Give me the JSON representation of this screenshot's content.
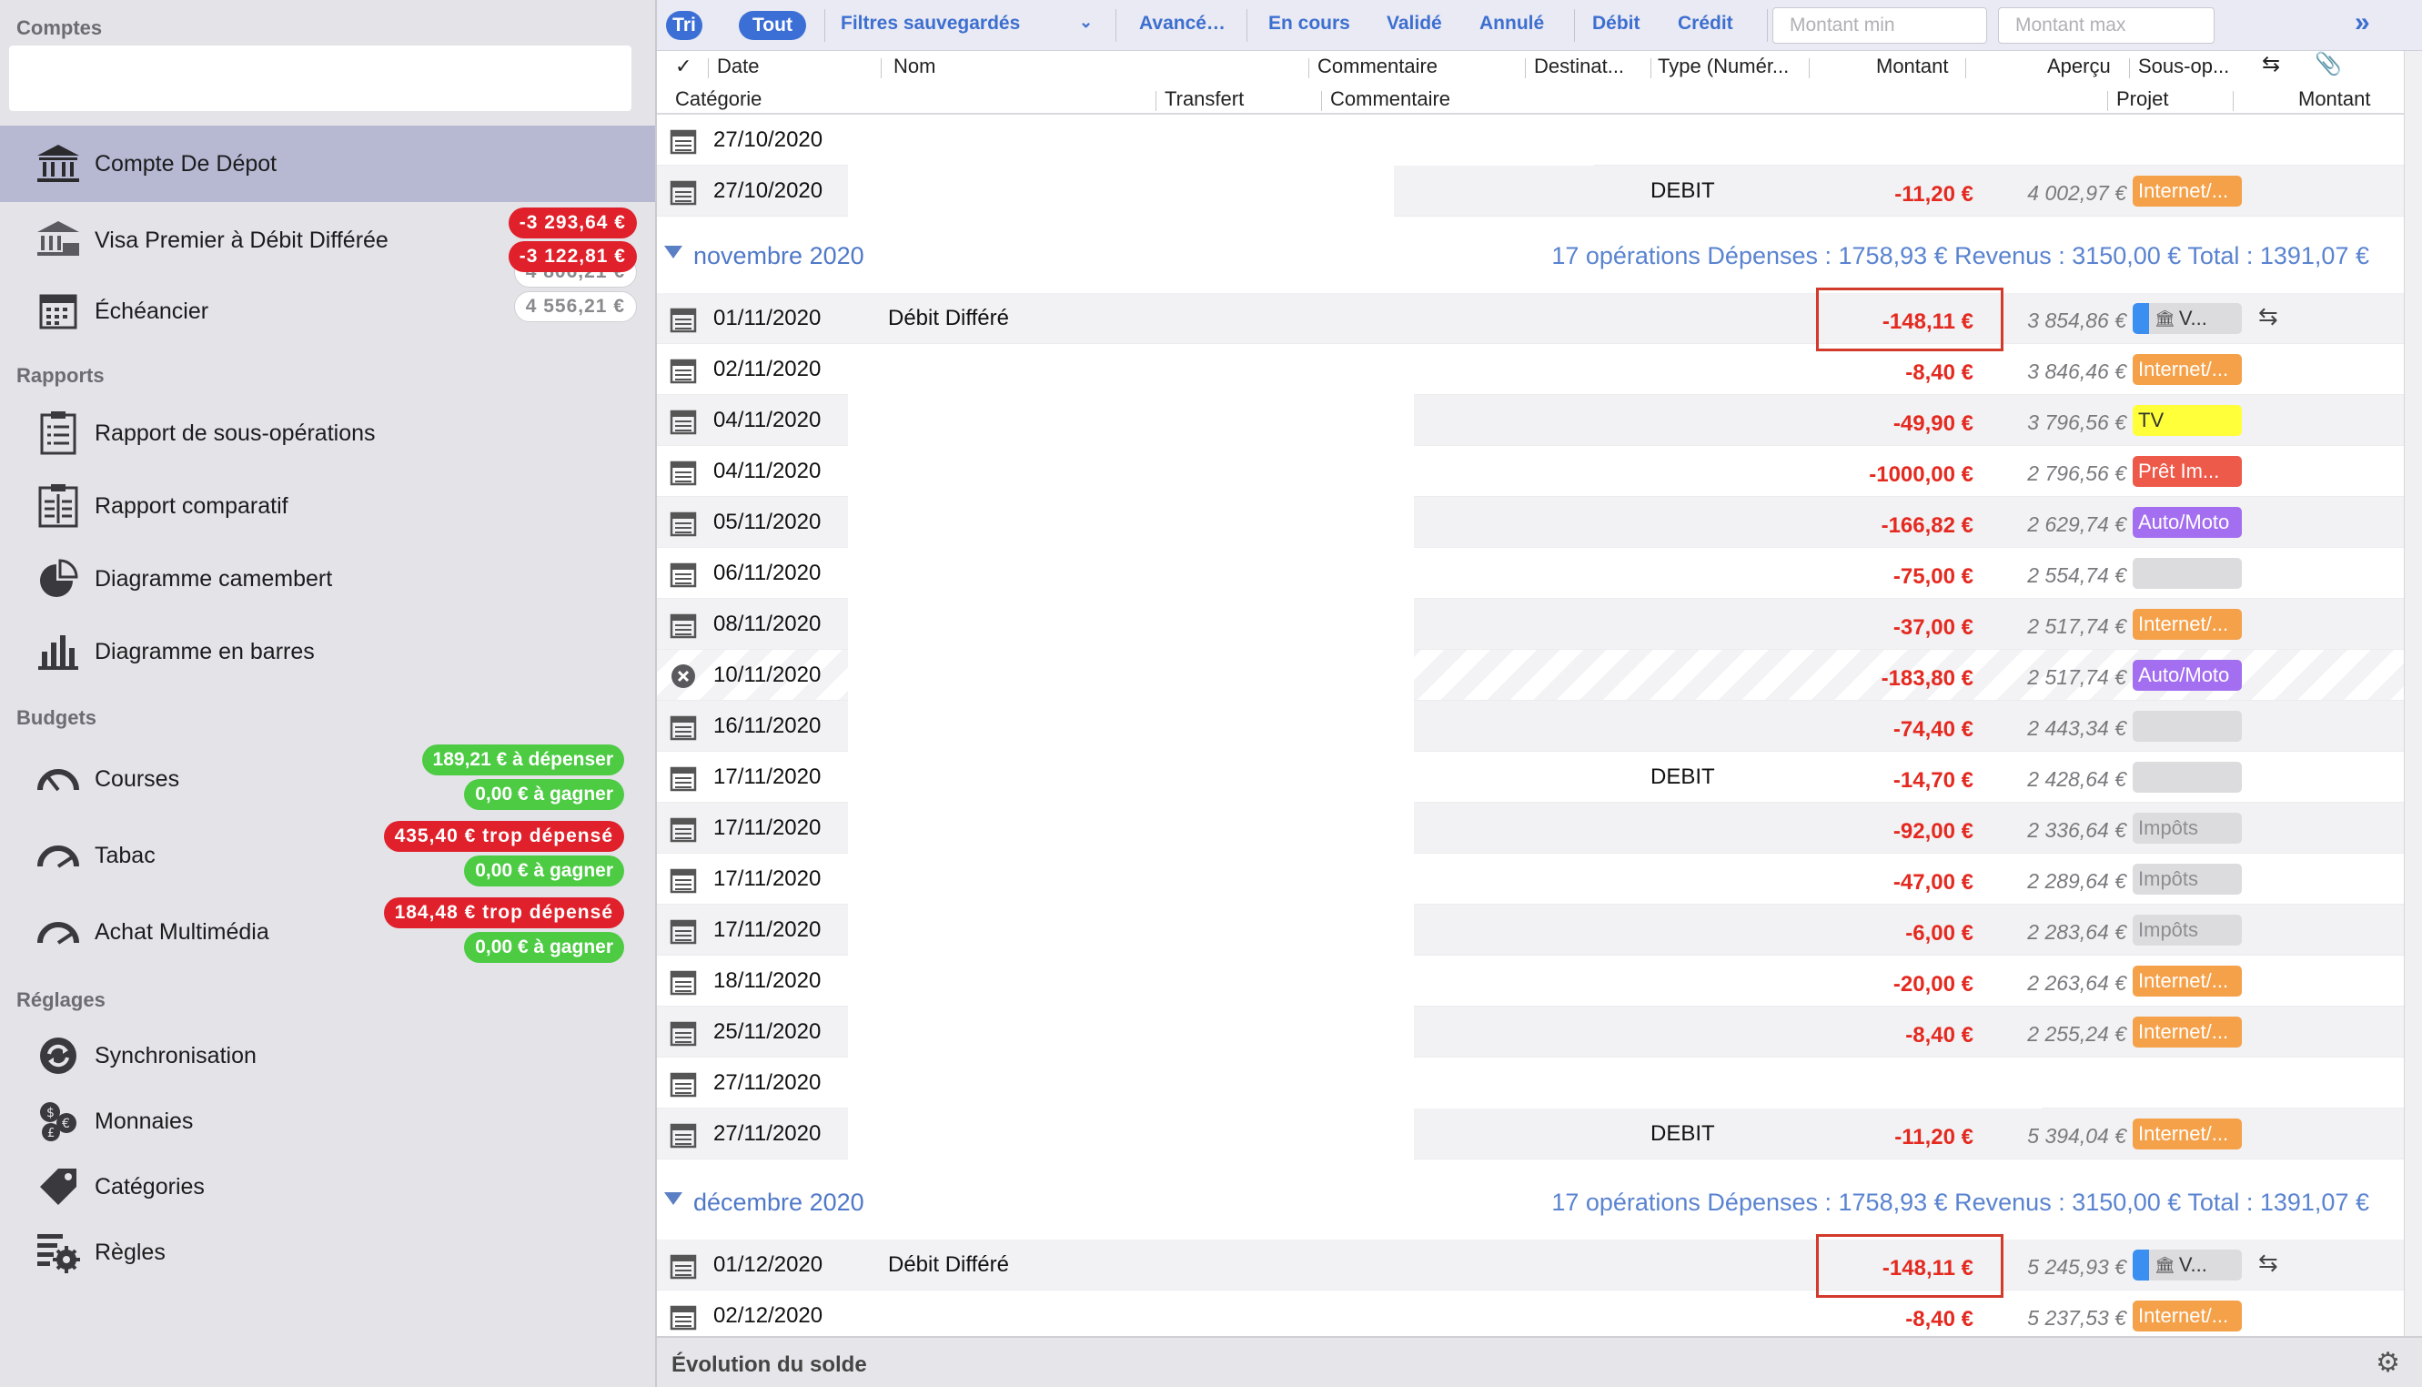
{
  "sidebar": {
    "sections": {
      "comptes": "Comptes",
      "rapports": "Rapports",
      "budgets": "Budgets",
      "reglages": "Réglages"
    },
    "accounts": [
      {
        "label": "Compte De Dépot",
        "balances": [
          "4 806,21 €",
          "4 556,21 €"
        ]
      },
      {
        "label": "Visa Premier à Débit Différée",
        "balances": [
          "-3 293,64 €",
          "-3 122,81 €"
        ]
      },
      {
        "label": "Échéancier"
      }
    ],
    "reports": [
      {
        "label": "Rapport de sous-opérations",
        "icon": "report-list-icon"
      },
      {
        "label": "Rapport comparatif",
        "icon": "report-compare-icon"
      },
      {
        "label": "Diagramme camembert",
        "icon": "pie-chart-icon"
      },
      {
        "label": "Diagramme en barres",
        "icon": "bar-chart-icon"
      }
    ],
    "budgets": [
      {
        "label": "Courses",
        "status": "189,21 € à dépenser",
        "earn": "0,00 € à gagner"
      },
      {
        "label": "Tabac",
        "status": "435,40 € trop dépensé",
        "earn": "0,00 € à gagner"
      },
      {
        "label": "Achat Multimédia",
        "status": "184,48 € trop dépensé",
        "earn": "0,00 € à gagner"
      }
    ],
    "settings": [
      {
        "label": "Synchronisation",
        "icon": "sync-icon"
      },
      {
        "label": "Monnaies",
        "icon": "currency-icon"
      },
      {
        "label": "Catégories",
        "icon": "tag-icon"
      },
      {
        "label": "Règles",
        "icon": "rules-gear-icon"
      }
    ]
  },
  "toolbar": {
    "tri": "Tri",
    "tout": "Tout",
    "saved_filters": "Filtres sauvegardés",
    "advanced": "Avancé…",
    "en_cours": "En cours",
    "valide": "Validé",
    "annule": "Annulé",
    "debit": "Débit",
    "credit": "Crédit",
    "min_placeholder": "Montant min",
    "max_placeholder": "Montant max"
  },
  "columns": {
    "check": "✓",
    "date": "Date",
    "nom": "Nom",
    "commentaire": "Commentaire",
    "destinataire": "Destinat...",
    "type": "Type (Numér...",
    "montant": "Montant",
    "apercu": "Aperçu",
    "sous_op": "Sous-op...",
    "categorie": "Catégorie",
    "transfert": "Transfert",
    "commentaire2": "Commentaire",
    "projet": "Projet",
    "montant2": "Montant"
  },
  "groups": [
    {
      "title": "novembre 2020",
      "summary": "17 opérations   Dépenses : 1758,93 €   Revenus : 3150,00 €   Total : 1391,07 €"
    },
    {
      "title": "décembre 2020",
      "summary": "17 opérations   Dépenses : 1758,93 €   Revenus : 3150,00 €   Total : 1391,07 €"
    }
  ],
  "transactions": {
    "oct": [
      {
        "date": "27/10/2020",
        "name": "",
        "type": "",
        "amount": "",
        "balance": "",
        "tag": ""
      },
      {
        "date": "27/10/2020",
        "name": "",
        "type": "DEBIT",
        "amount": "-11,20 €",
        "balance": "4 002,97 €",
        "tag": "Internet/..."
      }
    ],
    "nov": [
      {
        "date": "01/11/2020",
        "name": "Débit Différé",
        "type": "",
        "amount": "-148,11 €",
        "balance": "3 854,86 €",
        "tag": "V..."
      },
      {
        "date": "02/11/2020",
        "name": "",
        "type": "",
        "amount": "-8,40 €",
        "balance": "3 846,46 €",
        "tag": "Internet/..."
      },
      {
        "date": "04/11/2020",
        "name": "",
        "type": "",
        "amount": "-49,90 €",
        "balance": "3 796,56 €",
        "tag": "TV"
      },
      {
        "date": "04/11/2020",
        "name": "",
        "type": "",
        "amount": "-1000,00 €",
        "balance": "2 796,56 €",
        "tag": "Prêt Im..."
      },
      {
        "date": "05/11/2020",
        "name": "",
        "type": "",
        "amount": "-166,82 €",
        "balance": "2 629,74 €",
        "tag": "Auto/Moto"
      },
      {
        "date": "06/11/2020",
        "name": "",
        "type": "",
        "amount": "-75,00 €",
        "balance": "2 554,74 €",
        "tag": ""
      },
      {
        "date": "08/11/2020",
        "name": "",
        "type": "",
        "amount": "-37,00 €",
        "balance": "2 517,74 €",
        "tag": "Internet/..."
      },
      {
        "date": "10/11/2020",
        "name": "",
        "type": "",
        "amount": "-183,80 €",
        "balance": "2 517,74 €",
        "tag": "Auto/Moto"
      },
      {
        "date": "16/11/2020",
        "name": "",
        "type": "",
        "amount": "-74,40 €",
        "balance": "2 443,34 €",
        "tag": ""
      },
      {
        "date": "17/11/2020",
        "name": "",
        "type": "DEBIT",
        "amount": "-14,70 €",
        "balance": "2 428,64 €",
        "tag": ""
      },
      {
        "date": "17/11/2020",
        "name": "",
        "type": "",
        "amount": "-92,00 €",
        "balance": "2 336,64 €",
        "tag": "Impôts"
      },
      {
        "date": "17/11/2020",
        "name": "",
        "type": "",
        "amount": "-47,00 €",
        "balance": "2 289,64 €",
        "tag": "Impôts"
      },
      {
        "date": "17/11/2020",
        "name": "",
        "type": "",
        "amount": "-6,00 €",
        "balance": "2 283,64 €",
        "tag": "Impôts"
      },
      {
        "date": "18/11/2020",
        "name": "",
        "type": "",
        "amount": "-20,00 €",
        "balance": "2 263,64 €",
        "tag": "Internet/..."
      },
      {
        "date": "25/11/2020",
        "name": "",
        "type": "",
        "amount": "-8,40 €",
        "balance": "2 255,24 €",
        "tag": "Internet/..."
      },
      {
        "date": "27/11/2020",
        "name": "",
        "type": "",
        "amount": "",
        "balance": "",
        "tag": ""
      },
      {
        "date": "27/11/2020",
        "name": "",
        "type": "DEBIT",
        "amount": "-11,20 €",
        "balance": "5 394,04 €",
        "tag": "Internet/..."
      }
    ],
    "dec": [
      {
        "date": "01/12/2020",
        "name": "Débit Différé",
        "type": "",
        "amount": "-148,11 €",
        "balance": "5 245,93 €",
        "tag": "V..."
      },
      {
        "date": "02/12/2020",
        "name": "",
        "type": "",
        "amount": "-8,40 €",
        "balance": "5 237,53 €",
        "tag": "Internet/..."
      }
    ]
  },
  "footer": {
    "title": "Évolution du solde"
  },
  "colors": {
    "accent": "#3c6fd6",
    "negative": "#e42a20",
    "tag_internet": "#f5a14a",
    "tag_tv": "#ffff3a",
    "tag_pret": "#ee5a4a",
    "tag_auto": "#a36ff0",
    "tag_impots": "#dcdcdf",
    "tag_empty": "#dcdcdf",
    "bank_blue": "#3a8ff0"
  }
}
